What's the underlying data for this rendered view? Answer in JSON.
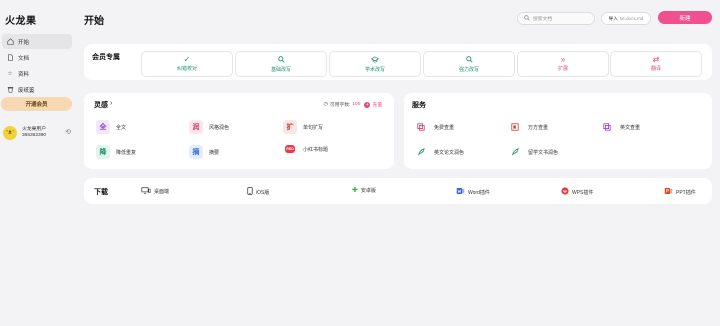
{
  "app": {
    "logo": "火龙果"
  },
  "sidebar": {
    "items": [
      {
        "label": "开始",
        "icon": "home-icon"
      },
      {
        "label": "文档",
        "icon": "document-icon"
      },
      {
        "label": "资料",
        "icon": "star-icon"
      },
      {
        "label": "废纸篓",
        "icon": "trash-icon"
      }
    ],
    "upgrade_label": "开通会员",
    "user": {
      "name": "火龙果用户",
      "id": "365362390"
    }
  },
  "header": {
    "title": "开始",
    "search_placeholder": "搜索文档",
    "import_label": "导入",
    "import_hint": "txt,docx,md",
    "new_label": "新建"
  },
  "member": {
    "title": "会员专属",
    "tiles": [
      {
        "label": "纠错校对",
        "icon": "check-icon",
        "color": "teal"
      },
      {
        "label": "基础改写",
        "icon": "search-icon",
        "color": "teal"
      },
      {
        "label": "学术改写",
        "icon": "graduation-cap-icon",
        "color": "teal"
      },
      {
        "label": "强力改写",
        "icon": "search-icon",
        "color": "teal"
      },
      {
        "label": "扩展",
        "icon": "double-chevron-icon",
        "color": "pink"
      },
      {
        "label": "翻译",
        "icon": "swap-icon",
        "color": "pink"
      }
    ]
  },
  "inspiration": {
    "title": "灵感",
    "quota_label": "可用字数:",
    "quota_value": "100",
    "charge_label": "充值",
    "tools": [
      {
        "label": "全文",
        "glyph": "全",
        "color": "#8a3fd1",
        "bg": "#f1e8fb"
      },
      {
        "label": "风格润色",
        "glyph": "润",
        "color": "#d03a6a",
        "bg": "#fbe6ee"
      },
      {
        "label": "单句扩写",
        "glyph": "扩",
        "color": "#d03a3a",
        "bg": "#fbe6e6"
      },
      {
        "label": "降低重复",
        "glyph": "降",
        "color": "#1f8f6f",
        "bg": "#e2f4ee"
      },
      {
        "label": "摘要",
        "glyph": "摘",
        "color": "#2f6fd6",
        "bg": "#e4edfb"
      },
      {
        "label": "小红书标题",
        "glyph": "RED",
        "color": "#ffffff",
        "bg": "#ea3a4a"
      }
    ]
  },
  "service": {
    "title": "服务",
    "items": [
      {
        "label": "免费查重",
        "icon": "copy-icon",
        "color": "#d03a6a"
      },
      {
        "label": "万方查重",
        "icon": "wanfang-icon",
        "color": "#d03a3a"
      },
      {
        "label": "英文查重",
        "icon": "copy-icon",
        "color": "#8a3fd1"
      },
      {
        "label": "英文论文润色",
        "icon": "quill-icon",
        "color": "#1f8f6f"
      },
      {
        "label": "留学文书润色",
        "icon": "quill-icon",
        "color": "#1f8f6f"
      }
    ]
  },
  "download": {
    "title": "下载",
    "items": [
      {
        "label": "桌面端",
        "icon": "desktop-icon"
      },
      {
        "label": "iOS版",
        "icon": "phone-icon"
      },
      {
        "label": "安卓版",
        "icon": "android-icon"
      },
      {
        "label": "Word插件",
        "icon": "word-icon"
      },
      {
        "label": "WPS插件",
        "icon": "wps-icon"
      },
      {
        "label": "PPT插件",
        "icon": "ppt-icon"
      }
    ]
  }
}
